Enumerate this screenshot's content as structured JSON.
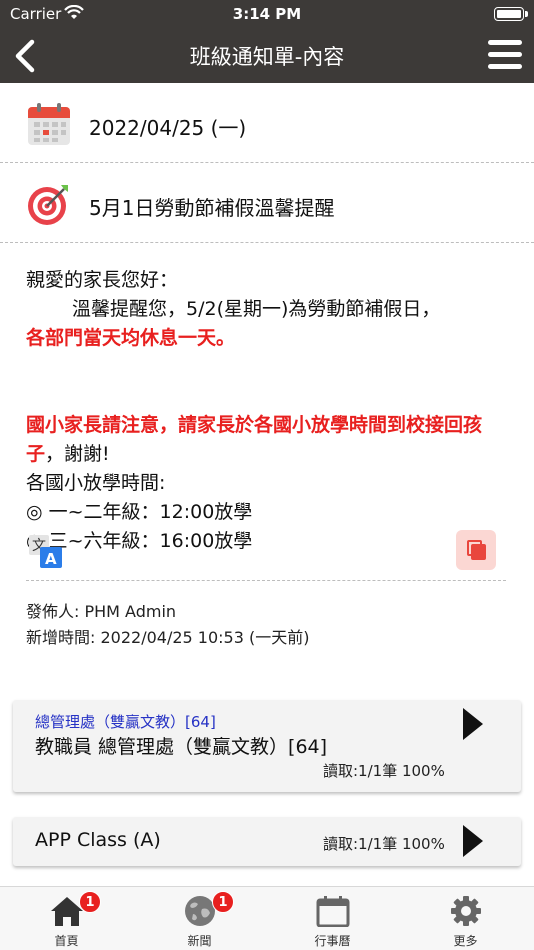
{
  "status_bar": {
    "carrier": "Carrier",
    "time": "3:14 PM"
  },
  "nav": {
    "title": "班級通知單-內容"
  },
  "notice": {
    "date": "2022/04/25 (一)",
    "subject": "5月1日勞動節補假溫馨提醒",
    "body": {
      "greeting": "親愛的家長您好：",
      "line1": "溫馨提醒您，5/2(星期一)為勞動節補假日，",
      "line1_red": "各部門當天均休息一天。",
      "red2": "國小家長請注意，請家長於各國小放學時間到校接回孩子",
      "thanks": "，謝謝!",
      "times_title": "各國小放學時間:",
      "time1": "◎ 一~二年級：12:00放學",
      "time2": "◎ 三~六年級：16:00放學"
    },
    "publisher": "發佈人: PHM Admin",
    "created": "新增時間: 2022/04/25 10:53 (一天前)"
  },
  "recipients": [
    {
      "tag": "總管理處（雙贏文教）[64]",
      "name": "教職員 總管理處（雙贏文教）[64]",
      "read": "讀取:1/1筆 100%"
    },
    {
      "tag": "",
      "name": "APP Class (A)",
      "read": "讀取:1/1筆 100%"
    }
  ],
  "tabs": [
    {
      "label": "首頁",
      "icon": "home-icon",
      "badge": "1"
    },
    {
      "label": "新聞",
      "icon": "globe-icon",
      "badge": "1"
    },
    {
      "label": "行事曆",
      "icon": "calendar-icon",
      "badge": ""
    },
    {
      "label": "更多",
      "icon": "gear-icon",
      "badge": ""
    }
  ],
  "colors": {
    "nav_bg": "#3d3a38",
    "highlight_red": "#e8201f",
    "tag_blue": "#2632c5",
    "badge_red": "#e8201f"
  }
}
